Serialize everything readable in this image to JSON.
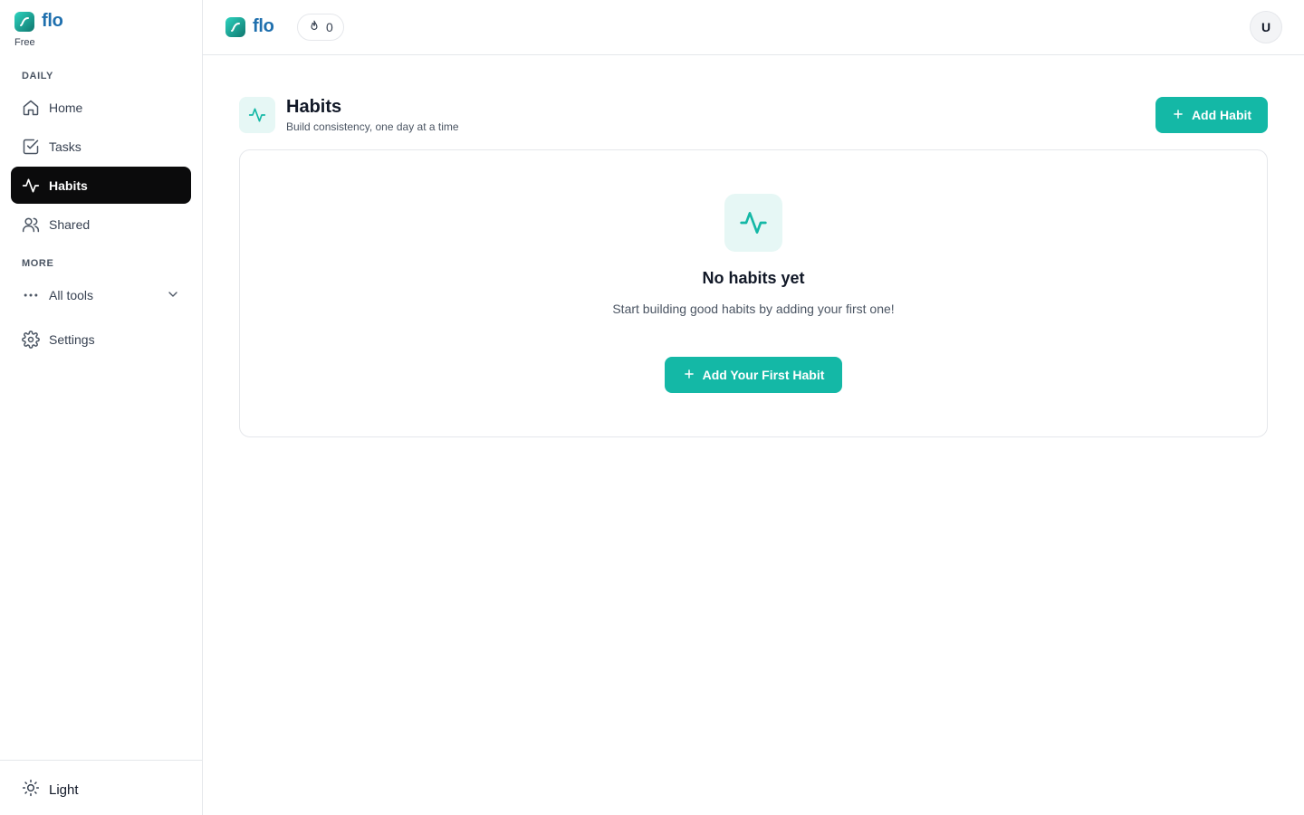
{
  "brand": {
    "name": "flo",
    "plan": "Free",
    "color": "#1e6fae"
  },
  "sidebar": {
    "section_daily": "DAILY",
    "section_more": "MORE",
    "items": [
      {
        "label": "Home",
        "icon": "home-icon"
      },
      {
        "label": "Tasks",
        "icon": "checkbox-icon"
      },
      {
        "label": "Habits",
        "icon": "activity-icon",
        "active": true
      },
      {
        "label": "Shared",
        "icon": "users-icon"
      },
      {
        "label": "All tools",
        "icon": "more-horizontal-icon",
        "expandable": true
      },
      {
        "label": "Settings",
        "icon": "gear-icon"
      }
    ],
    "theme_label": "Light"
  },
  "topbar": {
    "brand_name": "flo",
    "streak_count": "0",
    "avatar_initial": "U"
  },
  "main": {
    "title": "Habits",
    "subtitle": "Build consistency, one day at a time",
    "add_button": "Add Habit",
    "empty": {
      "title": "No habits yet",
      "description": "Start building good habits by adding your first one!",
      "button": "Add Your First Habit"
    }
  },
  "colors": {
    "accent": "#14b8a6",
    "accent_bg": "#e6f7f5",
    "active_nav": "#0b0b0c"
  }
}
